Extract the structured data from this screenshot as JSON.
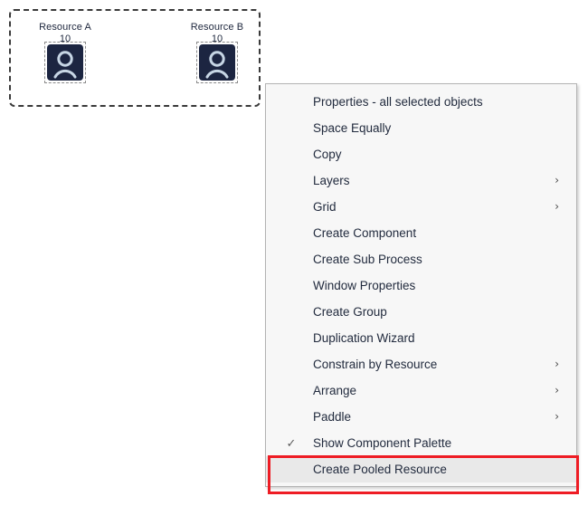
{
  "canvas": {
    "selection_marquee": "multi-object selection",
    "resources": [
      {
        "name": "Resource A",
        "quantity": "10",
        "icon": "person-icon",
        "icon_color": "#1c2541",
        "glyph_color": "#c7d6e5",
        "selected": true
      },
      {
        "name": "Resource B",
        "quantity": "10",
        "icon": "person-icon",
        "icon_color": "#1c2541",
        "glyph_color": "#c7d6e5",
        "selected": true
      }
    ]
  },
  "context_menu": {
    "background": "#f7f7f7",
    "border_color": "#b3b3b3",
    "text_color": "#222b3e",
    "items": [
      {
        "label": "Properties - all selected objects",
        "submenu": false,
        "checked": false,
        "highlighted": false
      },
      {
        "label": "Space Equally",
        "submenu": false,
        "checked": false,
        "highlighted": false
      },
      {
        "label": "Copy",
        "submenu": false,
        "checked": false,
        "highlighted": false
      },
      {
        "label": "Layers",
        "submenu": true,
        "checked": false,
        "highlighted": false
      },
      {
        "label": "Grid",
        "submenu": true,
        "checked": false,
        "highlighted": false
      },
      {
        "label": "Create Component",
        "submenu": false,
        "checked": false,
        "highlighted": false
      },
      {
        "label": "Create Sub Process",
        "submenu": false,
        "checked": false,
        "highlighted": false
      },
      {
        "label": "Window Properties",
        "submenu": false,
        "checked": false,
        "highlighted": false
      },
      {
        "label": "Create Group",
        "submenu": false,
        "checked": false,
        "highlighted": false
      },
      {
        "label": "Duplication Wizard",
        "submenu": false,
        "checked": false,
        "highlighted": false
      },
      {
        "label": "Constrain by Resource",
        "submenu": true,
        "checked": false,
        "highlighted": false
      },
      {
        "label": "Arrange",
        "submenu": true,
        "checked": false,
        "highlighted": false
      },
      {
        "label": "Paddle",
        "submenu": true,
        "checked": false,
        "highlighted": false
      },
      {
        "label": "Show Component Palette",
        "submenu": false,
        "checked": true,
        "highlighted": false
      },
      {
        "label": "Create Pooled Resource",
        "submenu": false,
        "checked": false,
        "highlighted": true
      }
    ],
    "submenu_glyph": "›",
    "check_glyph": "✓"
  },
  "annotation": {
    "target_label": "Create Pooled Resource",
    "color": "#ee1c24"
  }
}
